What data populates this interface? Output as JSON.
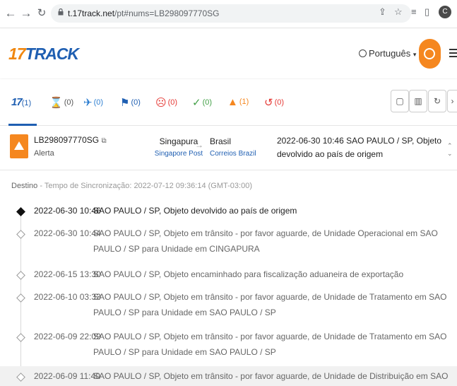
{
  "browser": {
    "url_host": "t.17track.net",
    "url_path": "/pt#nums=LB298097770SG",
    "avatar_initial": "C"
  },
  "header": {
    "logo_digits": "17",
    "logo_text": "TRACK",
    "language": "Português",
    "brand_colors": {
      "orange": "#f5871f",
      "blue": "#1f5fb2"
    }
  },
  "filters": [
    {
      "name": "all",
      "count": "(1)"
    },
    {
      "name": "not-found",
      "count": "(0)"
    },
    {
      "name": "in-transit",
      "count": "(0)"
    },
    {
      "name": "pick-up",
      "count": "(0)"
    },
    {
      "name": "undelivered",
      "count": "(0)"
    },
    {
      "name": "delivered",
      "count": "(0)"
    },
    {
      "name": "alert",
      "count": "(1)"
    },
    {
      "name": "expired",
      "count": "(0)"
    }
  ],
  "parcel": {
    "number": "LB298097770SG",
    "status": "Alerta",
    "origin_country": "Singapura",
    "origin_carrier": "Singapore Post",
    "dest_country": "Brasil",
    "dest_carrier": "Correios Brazil",
    "latest_event": "2022-06-30 10:46  SAO PAULO / SP, Objeto devolvido ao país de origem"
  },
  "sync": {
    "label": "Destino",
    "text": " - Tempo de Sincronização: 2022-07-12 09:36:14 (GMT-03:00)"
  },
  "events": [
    {
      "time": "2022-06-30 10:46",
      "desc": "SAO PAULO / SP, Objeto devolvido ao país de origem"
    },
    {
      "time": "2022-06-30 10:44",
      "desc": "SAO PAULO / SP, Objeto em trânsito - por favor aguarde, de Unidade Operacional em SAO PAULO / SP para Unidade em CINGAPURA"
    },
    {
      "time": "2022-06-15 13:30",
      "desc": "SAO PAULO / SP, Objeto encaminhado para fiscalização aduaneira de exportação"
    },
    {
      "time": "2022-06-10 03:33",
      "desc": "SAO PAULO / SP, Objeto em trânsito - por favor aguarde, de Unidade de Tratamento em SAO PAULO / SP para Unidade em SAO PAULO / SP"
    },
    {
      "time": "2022-06-09 22:09",
      "desc": "SAO PAULO / SP, Objeto em trânsito - por favor aguarde, de Unidade de Tratamento em SAO PAULO / SP para Unidade em SAO PAULO / SP"
    },
    {
      "time": "2022-06-09 11:40",
      "desc": "SAO PAULO / SP, Objeto em trânsito - por favor aguarde, de Unidade de Distribuição em SAO PAULO / SP para Unidade em"
    }
  ]
}
